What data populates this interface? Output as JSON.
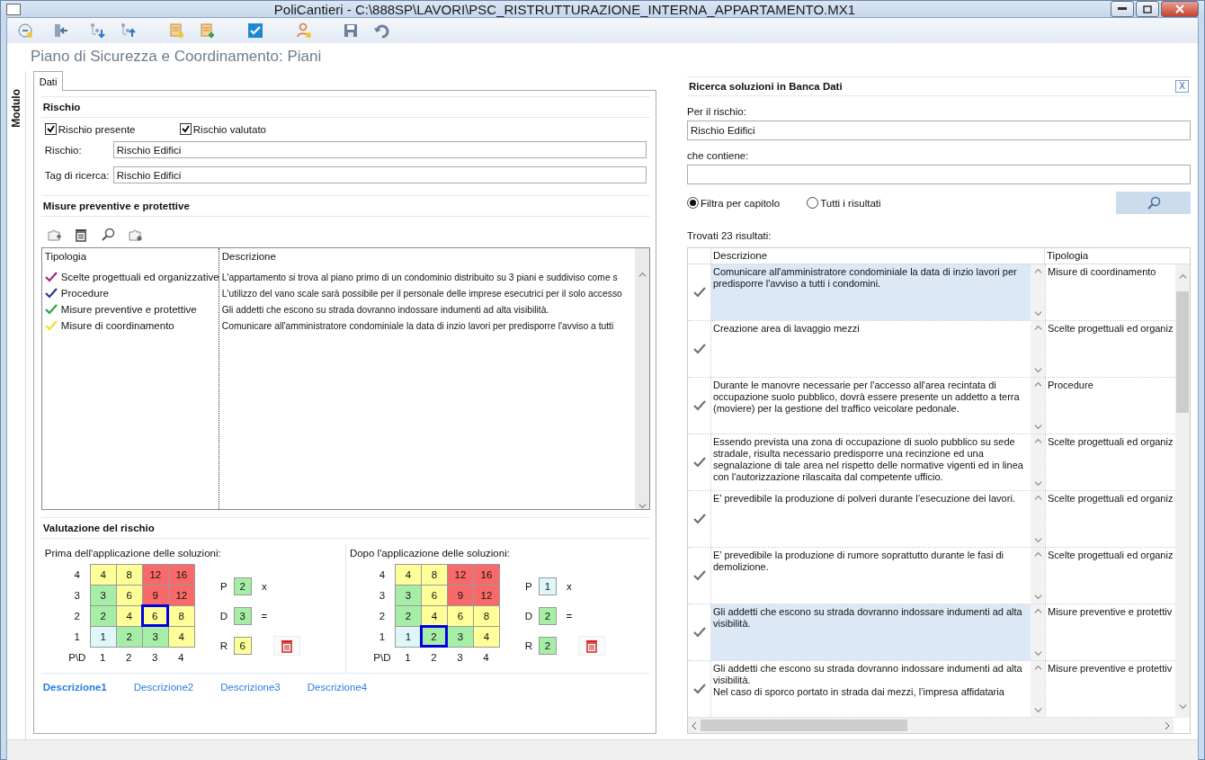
{
  "window": {
    "title": "PoliCantieri - C:\\888SP\\LAVORI\\PSC_RISTRUTTURAZIONE_INTERNA_APPARTAMENTO.MX1"
  },
  "page_title": "Piano di Sicurezza e Coordinamento: Piani",
  "side_tab": "Modulo",
  "tabs": [
    {
      "label": "Dati",
      "selected": true
    }
  ],
  "rischio": {
    "heading": "Rischio",
    "checkboxes": [
      {
        "label": "Rischio presente",
        "checked": true
      },
      {
        "label": "Rischio valutato",
        "checked": true
      }
    ],
    "fields": [
      {
        "label": "Rischio:",
        "value": "Rischio Edifici"
      },
      {
        "label": "Tag di ricerca:",
        "value": "Rischio Edifici"
      }
    ]
  },
  "misure": {
    "heading": "Misure preventive e protettive",
    "columns": [
      "Tipologia",
      "Descrizione"
    ],
    "rows": [
      {
        "tipologia": "Scelte progettuali ed organizzative",
        "color": "#9b2a86",
        "descrizione": "L'appartamento si trova al piano primo di un condominio distribuito su 3 piani e suddiviso come s"
      },
      {
        "tipologia": "Procedure",
        "color": "#2d3a8c",
        "descrizione": "L'utilizzo del vano scale sarà possibile per il personale delle imprese esecutrici per il solo accesso"
      },
      {
        "tipologia": "Misure preventive e protettive",
        "color": "#2e9e3e",
        "descrizione": "Gli addetti che escono su strada dovranno indossare indumenti ad alta visibilità."
      },
      {
        "tipologia": "Misure di coordinamento",
        "color": "#f0e020",
        "descrizione": "Comunicare all'amministratore condominiale la data di inzio lavori per predisporre l'avviso a tutti"
      }
    ]
  },
  "valutazione": {
    "heading": "Valutazione del rischio",
    "panels": [
      {
        "caption": "Prima dell'applicazione delle soluzioni:",
        "matrix": {
          "rows": [
            {
              "label": "4",
              "cells": [
                {
                  "value": "4",
                  "color": "#ffff99",
                  "selected": false
                },
                {
                  "value": "8",
                  "color": "#ffff99",
                  "selected": false
                },
                {
                  "value": "12",
                  "color": "#f86a6a",
                  "selected": false
                },
                {
                  "value": "16",
                  "color": "#f86a6a",
                  "selected": false
                }
              ]
            },
            {
              "label": "3",
              "cells": [
                {
                  "value": "3",
                  "color": "#a6eea6",
                  "selected": false
                },
                {
                  "value": "6",
                  "color": "#ffff99",
                  "selected": false
                },
                {
                  "value": "9",
                  "color": "#f86a6a",
                  "selected": false
                },
                {
                  "value": "12",
                  "color": "#f86a6a",
                  "selected": false
                }
              ]
            },
            {
              "label": "2",
              "cells": [
                {
                  "value": "2",
                  "color": "#a6eea6",
                  "selected": false
                },
                {
                  "value": "4",
                  "color": "#ffff99",
                  "selected": false
                },
                {
                  "value": "6",
                  "color": "#ffff99",
                  "selected": true
                },
                {
                  "value": "8",
                  "color": "#ffff99",
                  "selected": false
                }
              ]
            },
            {
              "label": "1",
              "cells": [
                {
                  "value": "1",
                  "color": "#dff7fb",
                  "selected": false
                },
                {
                  "value": "2",
                  "color": "#a6eea6",
                  "selected": false
                },
                {
                  "value": "3",
                  "color": "#a6eea6",
                  "selected": false
                },
                {
                  "value": "4",
                  "color": "#ffff99",
                  "selected": false
                }
              ]
            }
          ],
          "footer": [
            "P\\D",
            "1",
            "2",
            "3",
            "4"
          ]
        },
        "factors": [
          {
            "label": "P",
            "value": "2",
            "color": "#a6eea6",
            "operator": "x",
            "kind": "operand"
          },
          {
            "label": "D",
            "value": "3",
            "color": "#a6eea6",
            "operator": "=",
            "kind": "operand"
          },
          {
            "label": "R",
            "value": "6",
            "color": "#ffff99",
            "kind": "result"
          }
        ]
      },
      {
        "caption": "Dopo l'applicazione delle soluzioni:",
        "matrix": {
          "rows": [
            {
              "label": "4",
              "cells": [
                {
                  "value": "4",
                  "color": "#ffff99",
                  "selected": false
                },
                {
                  "value": "8",
                  "color": "#ffff99",
                  "selected": false
                },
                {
                  "value": "12",
                  "color": "#f86a6a",
                  "selected": false
                },
                {
                  "value": "16",
                  "color": "#f86a6a",
                  "selected": false
                }
              ]
            },
            {
              "label": "3",
              "cells": [
                {
                  "value": "3",
                  "color": "#a6eea6",
                  "selected": false
                },
                {
                  "value": "6",
                  "color": "#ffff99",
                  "selected": false
                },
                {
                  "value": "9",
                  "color": "#f86a6a",
                  "selected": false
                },
                {
                  "value": "12",
                  "color": "#f86a6a",
                  "selected": false
                }
              ]
            },
            {
              "label": "2",
              "cells": [
                {
                  "value": "2",
                  "color": "#a6eea6",
                  "selected": false
                },
                {
                  "value": "4",
                  "color": "#ffff99",
                  "selected": false
                },
                {
                  "value": "6",
                  "color": "#ffff99",
                  "selected": false
                },
                {
                  "value": "8",
                  "color": "#ffff99",
                  "selected": false
                }
              ]
            },
            {
              "label": "1",
              "cells": [
                {
                  "value": "1",
                  "color": "#dff7fb",
                  "selected": false
                },
                {
                  "value": "2",
                  "color": "#a6eea6",
                  "selected": true
                },
                {
                  "value": "3",
                  "color": "#a6eea6",
                  "selected": false
                },
                {
                  "value": "4",
                  "color": "#ffff99",
                  "selected": false
                }
              ]
            }
          ],
          "footer": [
            "P\\D",
            "1",
            "2",
            "3",
            "4"
          ]
        },
        "factors": [
          {
            "label": "P",
            "value": "1",
            "color": "#dff7fb",
            "operator": "x",
            "kind": "operand"
          },
          {
            "label": "D",
            "value": "2",
            "color": "#a6eea6",
            "operator": "=",
            "kind": "operand"
          },
          {
            "label": "R",
            "value": "2",
            "color": "#a6eea6",
            "kind": "result"
          }
        ]
      }
    ]
  },
  "desc_tabs": [
    {
      "label": "Descrizione1",
      "selected": true
    },
    {
      "label": "Descrizione2",
      "selected": false
    },
    {
      "label": "Descrizione3",
      "selected": false
    },
    {
      "label": "Descrizione4",
      "selected": false
    }
  ],
  "search_panel": {
    "title": "Ricerca soluzioni in Banca Dati",
    "close": "X",
    "fields": [
      {
        "label": "Per il rischio:",
        "value": "Rischio Edifici"
      },
      {
        "label": "che contiene:"
      }
    ],
    "radios": [
      {
        "label": "Filtra per capitolo",
        "selected": true
      },
      {
        "label": "Tutti i risultati",
        "selected": false
      }
    ],
    "result_count": "Trovati 23 risultati:",
    "columns": [
      "Descrizione",
      "Tipologia"
    ],
    "rows": [
      {
        "descrizione": "Comunicare all'amministratore condominiale la data di inzio lavori per predisporre l'avviso a tutti i condomini.",
        "tipologia": "Misure di coordinamento",
        "selected": true
      },
      {
        "descrizione": "Creazione area di lavaggio mezzi",
        "tipologia": "Scelte progettuali ed organiz",
        "selected": false
      },
      {
        "descrizione": "Durante le manovre necessarie per l'accesso all'area recintata di occupazione suolo pubblico, dovrà essere presente un addetto a terra (moviere) per la gestione del traffico veicolare pedonale.",
        "tipologia": "Procedure",
        "selected": false
      },
      {
        "descrizione": "Essendo prevista una zona di occupazione di suolo pubblico su sede stradale, risulta necessario predisporre una recinzione ed una segnalazione di tale area nel rispetto delle normative vigenti ed in linea con l'autorizzazione rilascaita dal competente ufficio.",
        "tipologia": "Scelte progettuali ed organiz",
        "selected": false
      },
      {
        "descrizione": "E’ prevedibile la produzione di polveri durante l’esecuzione dei lavori.",
        "tipologia": "Scelte progettuali ed organiz",
        "selected": false
      },
      {
        "descrizione": "E’ prevedibile la produzione di rumore soprattutto durante le fasi di demolizione.",
        "tipologia": "Scelte progettuali ed organiz",
        "selected": false
      },
      {
        "descrizione": "Gli addetti che escono su strada dovranno indossare indumenti ad alta visibilità.",
        "tipologia": "Misure preventive e protettiv",
        "selected": true
      },
      {
        "descrizione": "Gli addetti che escono su strada dovranno indossare indumenti ad alta visibilità.\nNel caso di sporco portato in strada dai mezzi, l’impresa affidataria",
        "tipologia": "Misure preventive e protettiv",
        "selected": false
      }
    ]
  }
}
